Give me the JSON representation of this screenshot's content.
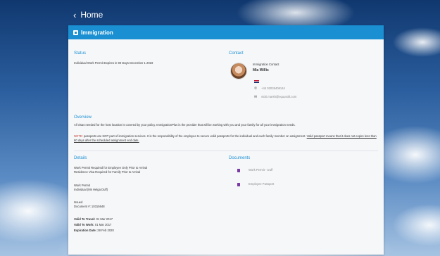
{
  "nav": {
    "back_icon": "chevron-left-icon",
    "title": "Home"
  },
  "header": {
    "icon": "document-icon",
    "title": "Immigration"
  },
  "status": {
    "title": "Status",
    "text": "Individual Work Permit Expires in 90 Days December 1 2019"
  },
  "contact": {
    "title": "Contact",
    "role": "Immigration Contact",
    "name": "Mia Willis",
    "flag_colors": [
      "#c8102e",
      "#ffffff",
      "#012169"
    ],
    "phone": "+44 02035406144",
    "email": "vicki.marsh@equusoft.com"
  },
  "overview": {
    "title": "Overview",
    "line1": "All visas needed for the host location is covered by your policy. ImmigrationPlus is the provider that will be working with you and your family for all your immigration needs.",
    "note_label": "NOTE:",
    "note_text": "passports are NOT part of immigration services. It is the responsibility of the employee to secure valid passports for the individual and each family member on assignment.",
    "note_link": "Valid passport means that it does not expire less than 60 days after the scheduled assignment end date."
  },
  "details": {
    "title": "Details",
    "req1": "Work Permit Required for Employee Only Prior to Arrival",
    "req2": "Residence Visa Required for Family Prior to Arrival",
    "type": "Work Permit",
    "holder": "Individual (Ms Helga Duff)",
    "state": "Issued",
    "doc_label": "Document #:",
    "doc_no": "10315648",
    "travel_label": "Valid To Travel:",
    "travel_date": "01 Mar 2017",
    "work_label": "Valid To Work:",
    "work_date": "01 Mar 2017",
    "exp_label": "Expiration Date:",
    "exp_date": "28 Feb 2020"
  },
  "documents": {
    "title": "Documents",
    "items": [
      "Work Permit - Duff",
      "Employee Passport"
    ]
  },
  "colors": {
    "accent": "#1a90d2",
    "note": "#c0392b",
    "doc_icon": "#7a3aa6"
  }
}
